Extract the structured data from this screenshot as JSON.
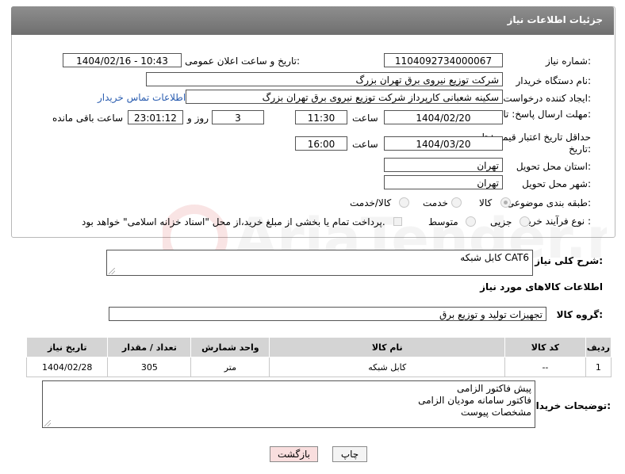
{
  "panel": {
    "title": "جزئیات اطلاعات نیاز"
  },
  "fields": {
    "need_number": {
      "label": "شماره نیاز:",
      "value": "1104092734000067"
    },
    "announce_datetime": {
      "label": "تاریخ و ساعت اعلان عمومی:",
      "value": "1404/02/16 - 10:43"
    },
    "buyer_org": {
      "label": "نام دستگاه خریدار:",
      "value": "شرکت توزیع نیروی برق تهران بزرگ"
    },
    "requester": {
      "label": "ایجاد کننده درخواست:",
      "value": "سکینه شعبانی کارپرداز شرکت توزیع نیروی برق تهران بزرگ",
      "contact_link": "اطلاعات تماس خریدار"
    },
    "reply_deadline": {
      "label": "مهلت ارسال پاسخ: تا تاریخ:",
      "date": "1404/02/20",
      "time_label": "ساعت",
      "time": "11:30",
      "days": "3",
      "days_label": "روز و",
      "remaining": "23:01:12",
      "remaining_label": "ساعت باقی مانده"
    },
    "price_validity": {
      "label": "حداقل تاریخ اعتبار قیمت: تا تاریخ:",
      "date": "1404/03/20",
      "time_label": "ساعت",
      "time": "16:00"
    },
    "province": {
      "label": "استان محل تحویل:",
      "value": "تهران"
    },
    "city": {
      "label": "شهر محل تحویل:",
      "value": "تهران"
    },
    "category": {
      "label": "طبقه بندی موضوعی:",
      "options": [
        "کالا",
        "خدمت",
        "کالا/خدمت"
      ]
    },
    "process": {
      "label": "نوع فرآیند خرید :",
      "options": [
        "جزیی",
        "متوسط"
      ],
      "note": "پرداخت تمام یا بخشی از مبلغ خرید،از محل \"اسناد خزانه اسلامی\" خواهد بود."
    }
  },
  "description": {
    "label": "شرح کلی نیاز:",
    "value": "کابل شبکه CAT6"
  },
  "goods_section": {
    "title": "اطلاعات کالاهای مورد نیاز"
  },
  "goods_group": {
    "label": "گروه کالا:",
    "value": "تجهیزات تولید و توزیع برق"
  },
  "table": {
    "headers": [
      "ردیف",
      "کد کالا",
      "نام کالا",
      "واحد شمارش",
      "تعداد / مقدار",
      "تاریخ نیاز"
    ],
    "rows": [
      [
        "1",
        "--",
        "کابل شبکه",
        "متر",
        "305",
        "1404/02/28"
      ]
    ]
  },
  "buyer_notes": {
    "label": "توضیحات خریدار:",
    "lines": [
      "پیش فاکتور الزامی",
      "فاکتور سامانه مودیان الزامی",
      "مشخصات پیوست"
    ]
  },
  "buttons": {
    "print": "چاپ",
    "back": "بازگشت"
  },
  "watermark": {
    "text": "AriaTender.neT"
  },
  "colors": {
    "header_bg": "#7f7f7f",
    "link": "#2a5db0",
    "back_btn_bg": "#f9dede"
  }
}
